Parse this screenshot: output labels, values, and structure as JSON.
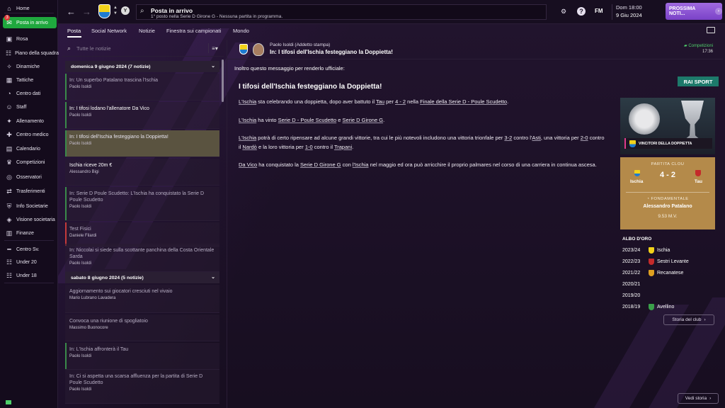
{
  "sidebar": {
    "items": [
      {
        "label": "Home",
        "icon": "home-icon",
        "glyph": "⌂"
      },
      {
        "label": "Posta in arrivo",
        "icon": "inbox-icon",
        "glyph": "✉",
        "active": true,
        "badge": "3"
      },
      {
        "label": "Rosa",
        "icon": "shirt-icon",
        "glyph": "▣"
      },
      {
        "label": "Piano della squadra",
        "icon": "people-icon",
        "glyph": "☷"
      },
      {
        "label": "Dinamiche",
        "icon": "dynamics-icon",
        "glyph": "✧"
      },
      {
        "label": "Tattiche",
        "icon": "tactics-icon",
        "glyph": "▦"
      },
      {
        "label": "Centro dati",
        "icon": "data-icon",
        "glyph": "◔"
      },
      {
        "label": "Staff",
        "icon": "staff-icon",
        "glyph": "☺"
      },
      {
        "label": "Allenamento",
        "icon": "training-icon",
        "glyph": "✦"
      },
      {
        "label": "Centro medico",
        "icon": "medical-icon",
        "glyph": "✚"
      },
      {
        "label": "Calendario",
        "icon": "calendar-icon",
        "glyph": "▤"
      },
      {
        "label": "Competizioni",
        "icon": "trophy-icon",
        "glyph": "♛"
      },
      {
        "label": "Osservatori",
        "icon": "scout-icon",
        "glyph": "◎"
      },
      {
        "label": "Trasferimenti",
        "icon": "transfer-icon",
        "glyph": "⇄"
      },
      {
        "label": "Info Societarie",
        "icon": "club-info-icon",
        "glyph": "⛨"
      },
      {
        "label": "Visione societaria",
        "icon": "vision-icon",
        "glyph": "◈"
      },
      {
        "label": "Finanze",
        "icon": "finance-icon",
        "glyph": "▥"
      },
      {
        "label": "Centro Sv.",
        "icon": "dev-centre-icon",
        "glyph": "━"
      },
      {
        "label": "Under 20",
        "icon": "u20-icon",
        "glyph": "☷"
      },
      {
        "label": "Under 18",
        "icon": "u18-icon",
        "glyph": "☷"
      }
    ]
  },
  "topbar": {
    "title": "Posta in arrivo",
    "subtitle": "1° posto nella Serie D Girone G - Nessuna partita in programma.",
    "time": "Dom 18:00",
    "date": "9 Giu 2024",
    "next_button": "PROSSIMA NOTI...",
    "fm_logo": "FM"
  },
  "tabs": [
    "Posta",
    "Social Network",
    "Notizie",
    "Finestra sui campionati",
    "Mondo"
  ],
  "filter_placeholder": "Tutte le notizie",
  "groups": [
    {
      "label": "domenica 9 giugno 2024 (7 notizie)"
    },
    {
      "label": "sabato 8 giugno 2024 (5 notizie)"
    }
  ],
  "messages": [
    {
      "title": "In: Un superbo Patalano trascina l'Ischia",
      "sender": "Paolo Isoldi",
      "state": "read",
      "bar": "#3a8a4a"
    },
    {
      "title": "In: I tifosi lodano l'allenatore Da Vico",
      "sender": "Paolo Isoldi",
      "state": "unread",
      "bar": "#3a8a4a"
    },
    {
      "title": "In: I tifosi dell'Ischia festeggiano la Doppietta!",
      "sender": "Paolo Isoldi",
      "state": "selected",
      "bar": "#3a8a4a"
    },
    {
      "title": "Ischia riceve 20m €",
      "sender": "Alessandro Bigi",
      "state": "unread",
      "bar": ""
    },
    {
      "title": "In: Serie D Poule Scudetto: L'Ischia ha conquistato la Serie D Poule Scudetto",
      "sender": "Paolo Isoldi",
      "state": "read",
      "bar": "#3a8a4a"
    },
    {
      "title": "Test Fisici",
      "sender": "Daniele Filardi",
      "state": "read",
      "bar": "#c43a3a"
    },
    {
      "title": "In: Niccolai si siede sulla scottante panchina della Costa Orientale Sarda",
      "sender": "Paolo Isoldi",
      "state": "read",
      "bar": ""
    },
    {
      "title": "Aggiornamento sui giocatori cresciuti nel vivaio",
      "sender": "Mario Lubrano Lavadera",
      "state": "read",
      "bar": ""
    },
    {
      "title": "Convoca una riunione di spogliatoio",
      "sender": "Massimo Buonocore",
      "state": "read",
      "bar": ""
    },
    {
      "title": "In: L'Ischia affronterà il Tau",
      "sender": "Paolo Isoldi",
      "state": "read",
      "bar": "#3a8a4a"
    },
    {
      "title": "In: Ci si aspetta una scarsa affluenza per la partita di Serie D Poule Scudetto",
      "sender": "Paolo Isoldi",
      "state": "read",
      "bar": ""
    }
  ],
  "detail": {
    "from": "Paolo Isoldi  (Addetto stampa)",
    "subject": "In: I tifosi dell'Ischia festeggiano la Doppietta!",
    "category": "Competizioni",
    "time": "17:36",
    "intro": "Inoltro questo messaggio per renderlo ufficiale:",
    "article_title": "I tifosi dell'Ischia festeggiano la Doppietta!",
    "source_badge": "RAI SPORT",
    "trophy_label": "VINCITORI DELLA DOPPIETTA",
    "history_button": "Storia del club",
    "story_button": "Vedi storia"
  },
  "match": {
    "label": "PARTITA CLOU",
    "score": "4 - 2",
    "home": "Ischia",
    "away": "Tau",
    "fond_label": "FONDAMENTALE",
    "scorer": "Alessandro Patalano",
    "minute": "9.53 M.V."
  },
  "albo": {
    "title": "ALBO D'ORO",
    "rows": [
      {
        "year": "2023/24",
        "team": "Ischia",
        "color": "#f2d21a"
      },
      {
        "year": "2022/23",
        "team": "Sestri Levante",
        "color": "#c42a2a"
      },
      {
        "year": "2021/22",
        "team": "Recanatese",
        "color": "#e0a020"
      },
      {
        "year": "2020/21",
        "team": "",
        "color": ""
      },
      {
        "year": "2019/20",
        "team": "",
        "color": ""
      },
      {
        "year": "2018/19",
        "team": "Avellino",
        "color": "#3aa04a"
      }
    ]
  },
  "colors": {
    "accent_green": "#1fa83e",
    "next_purple": "#8a52d4",
    "match_gold": "#b48a4a",
    "rai": "#1d7a6b"
  }
}
